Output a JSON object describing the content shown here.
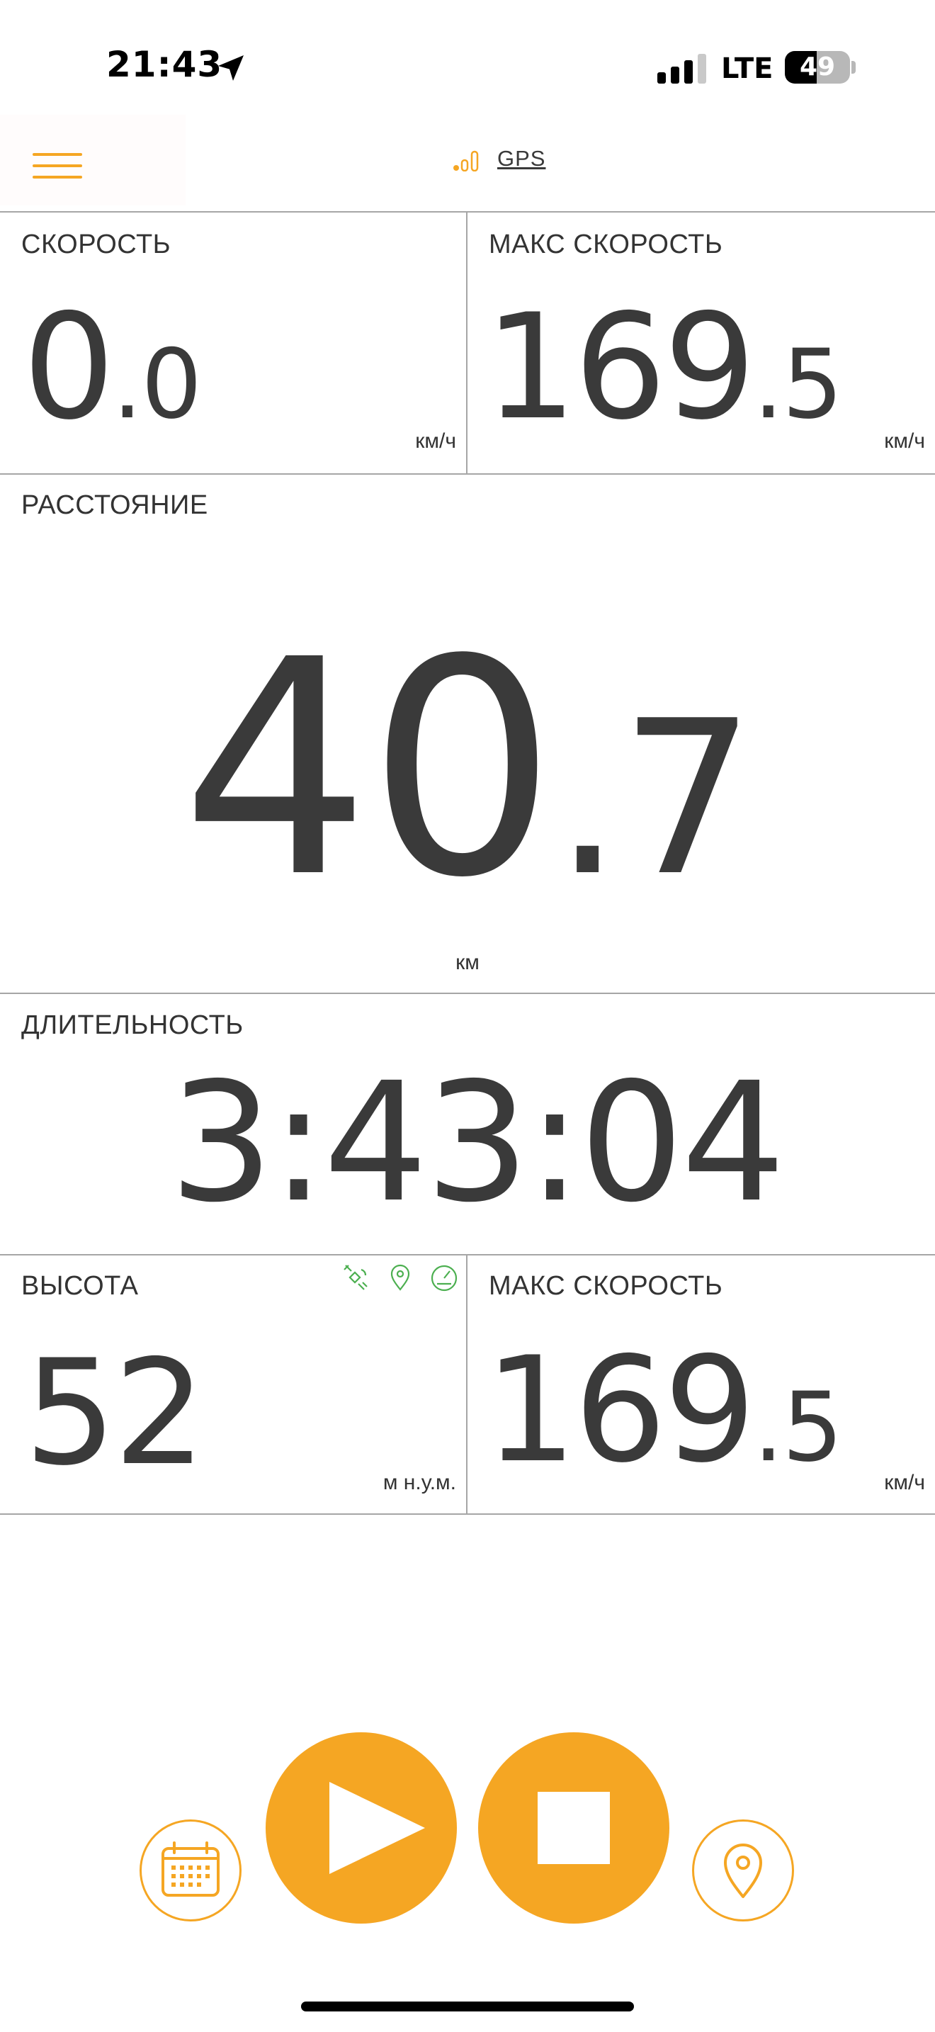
{
  "status_bar": {
    "time": "21:43",
    "network": "LTE",
    "battery_percent": "49",
    "battery_level": 0.49
  },
  "toolbar": {
    "menu_icon": "hamburger-menu-icon",
    "gps_label": "GPS",
    "gps_icon": "signal-strength-icon"
  },
  "speed": {
    "label": "СКОРОСТЬ",
    "value_int": "0",
    "value_dec": ".0",
    "unit": "км/ч"
  },
  "max_speed_top": {
    "label": "МАКС СКОРОСТЬ",
    "value_int": "169",
    "value_dec": ".5",
    "unit": "км/ч"
  },
  "distance": {
    "label": "РАССТОЯНИЕ",
    "value_int": "40",
    "value_dec": ".7",
    "unit": "км"
  },
  "duration": {
    "label": "ДЛИТЕЛЬНОСТЬ",
    "value": "3:43:04"
  },
  "altitude": {
    "label": "ВЫСОТА",
    "value": "52",
    "unit": "м н.у.м.",
    "mode_icons": [
      "satellite-icon",
      "map-pin-icon",
      "speedometer-icon"
    ]
  },
  "max_speed_bottom": {
    "label": "МАКС СКОРОСТЬ",
    "value_int": "169",
    "value_dec": ".5",
    "unit": "км/ч"
  },
  "controls": {
    "calendar_icon": "calendar-icon",
    "play_icon": "play-icon",
    "stop_icon": "stop-icon",
    "location_icon": "location-pin-icon"
  },
  "colors": {
    "accent": "#f5a623",
    "text": "#3a3a3a",
    "divider": "#a6a6a6",
    "mode_icons": "#4caf50"
  }
}
